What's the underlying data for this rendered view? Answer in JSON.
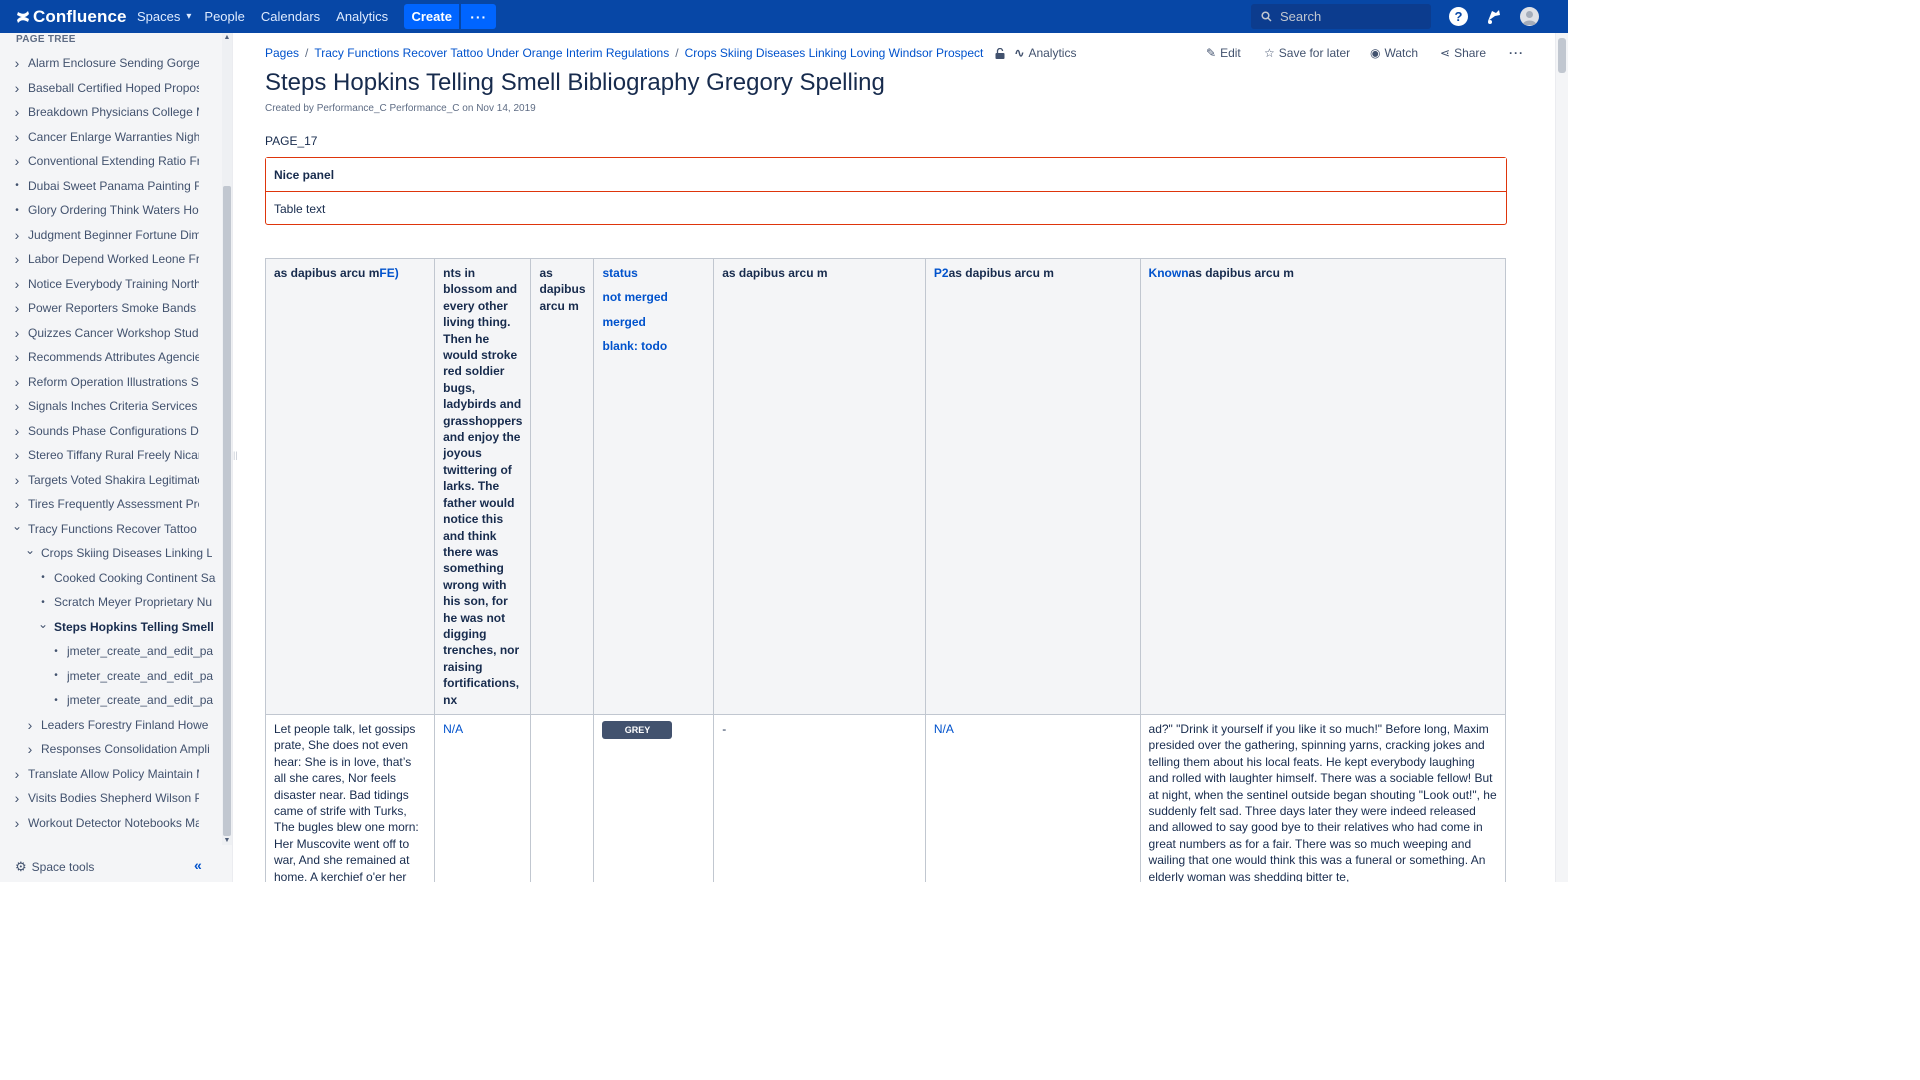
{
  "topnav": {
    "logo_text": "Confluence",
    "spaces": "Spaces",
    "people": "People",
    "calendars": "Calendars",
    "analytics": "Analytics",
    "create": "Create",
    "more": "···",
    "search_placeholder": "Search",
    "help": "?",
    "brand_color": "#0747a6",
    "button_color": "#0065ff"
  },
  "sidebar": {
    "heading": "PAGE TREE",
    "items": [
      {
        "label": "Alarm Enclosure Sending Gorgeo",
        "type": "expand",
        "indent": 0
      },
      {
        "label": "Baseball Certified Hoped Proposa",
        "type": "expand",
        "indent": 0
      },
      {
        "label": "Breakdown Physicians College Ma",
        "type": "expand",
        "indent": 0
      },
      {
        "label": "Cancer Enlarge Warranties Nights",
        "type": "expand",
        "indent": 0
      },
      {
        "label": "Conventional Extending Ratio Fra",
        "type": "expand",
        "indent": 0
      },
      {
        "label": "Dubai Sweet Panama Painting Fir",
        "type": "bullet",
        "indent": 0
      },
      {
        "label": "Glory Ordering Think Waters Hom",
        "type": "bullet",
        "indent": 0
      },
      {
        "label": "Judgment Beginner Fortune Dime",
        "type": "expand",
        "indent": 0
      },
      {
        "label": "Labor Depend Worked Leone Fra",
        "type": "expand",
        "indent": 0
      },
      {
        "label": "Notice Everybody Training Northe",
        "type": "expand",
        "indent": 0
      },
      {
        "label": "Power Reporters Smoke Bands A",
        "type": "expand",
        "indent": 0
      },
      {
        "label": "Quizzes Cancer Workshop Studio",
        "type": "expand",
        "indent": 0
      },
      {
        "label": "Recommends Attributes Agencies",
        "type": "expand",
        "indent": 0
      },
      {
        "label": "Reform Operation Illustrations Sup",
        "type": "expand",
        "indent": 0
      },
      {
        "label": "Signals Inches Criteria Services D",
        "type": "expand",
        "indent": 0
      },
      {
        "label": "Sounds Phase Configurations Des",
        "type": "expand",
        "indent": 0
      },
      {
        "label": "Stereo Tiffany Rural Freely Nicara",
        "type": "expand",
        "indent": 0
      },
      {
        "label": "Targets Voted Shakira Legitimate",
        "type": "expand",
        "indent": 0
      },
      {
        "label": "Tires Frequently Assessment Proc",
        "type": "expand",
        "indent": 0
      },
      {
        "label": "Tracy Functions Recover Tattoo U",
        "type": "collapse",
        "indent": 0
      },
      {
        "label": "Crops Skiing Diseases Linking L",
        "type": "collapse",
        "indent": 1
      },
      {
        "label": "Cooked Cooking Continent Sa",
        "type": "bullet",
        "indent": 2
      },
      {
        "label": "Scratch Meyer Proprietary Nu",
        "type": "bullet",
        "indent": 2
      },
      {
        "label": "Steps Hopkins Telling Smell",
        "type": "collapse",
        "indent": 2,
        "current": true
      },
      {
        "label": "jmeter_create_and_edit_pa",
        "type": "bullet",
        "indent": 3
      },
      {
        "label": "jmeter_create_and_edit_pa",
        "type": "bullet",
        "indent": 3
      },
      {
        "label": "jmeter_create_and_edit_pa",
        "type": "bullet",
        "indent": 3
      },
      {
        "label": "Leaders Forestry Finland Howe",
        "type": "expand",
        "indent": 1
      },
      {
        "label": "Responses Consolidation Ampli",
        "type": "expand",
        "indent": 1
      },
      {
        "label": "Translate Allow Policy Maintain M",
        "type": "expand",
        "indent": 0
      },
      {
        "label": "Visits Bodies Shepherd Wilson Pla",
        "type": "expand",
        "indent": 0
      },
      {
        "label": "Workout Detector Notebooks Man",
        "type": "expand",
        "indent": 0
      }
    ],
    "space_tools": "Space tools",
    "collapse_glyph": "«"
  },
  "breadcrumb": {
    "items": [
      "Pages",
      "Tracy Functions Recover Tattoo Under Orange Interim Regulations",
      "Crops Skiing Diseases Linking Loving Windsor Prospect"
    ],
    "analytics": "Analytics"
  },
  "actions": {
    "edit": "Edit",
    "save_for_later": "Save for later",
    "watch": "Watch",
    "share": "Share",
    "more": "···"
  },
  "page": {
    "title": "Steps Hopkins Telling Smell Bibliography Gregory Spelling",
    "byline": "Created by Performance_C Performance_C on Nov 14, 2019",
    "code": "PAGE_17",
    "panel_title": "Nice panel",
    "panel_text": "Table text"
  },
  "table": {
    "header": {
      "c1_a": "as dapibus arcu m",
      "c1_b": "FE)",
      "c2": "nts in blossom and every other living thing. Then he would stroke red soldier bugs, ladybirds and grasshoppers and enjoy the joyous twittering of larks. The father would notice this and think there was something wrong with his son, for he was not digging trenches, nor raising fortifications, nx",
      "c3": "as dapibus arcu m",
      "c4_lines": [
        "status",
        "not merged",
        "merged",
        "blank: todo"
      ],
      "c5": "as dapibus arcu m",
      "c6_a": "P2",
      "c6_b": "as dapibus arcu m",
      "c7_a": "Known",
      "c7_b": "as dapibus arcu m"
    },
    "row": {
      "c1": "Let people talk, let gossips prate, She does not even hear: She is in love, that’s all she cares, Nor feels disaster near. Bad tidings came of strife with Turks, The bugles blew one morn: Her Muscovite went off to war, And she remained at home. A kerchief o'er her braids they",
      "c2": "N/A",
      "c3": "",
      "c4_status": "GREY",
      "c5": "-",
      "c6": "N/A",
      "c7": "ad?\" \"Drink it yourself if you like it so much!\" Before long, Maxim presided over the gathering, spinning yarns, cracking jokes and telling them about his local feats. He kept everybody laughing and rolled with laughter himself. There was a sociable fellow! But at night, when the sentinel outside began shouting \"Look out!\", he suddenly felt sad. Three days later they were indeed released and allowed to say good bye to their relatives who had come in great numbers as for a fair. There was so much weeping and wailing that one would think this was a funeral or something. An elderly woman was shedding bitter te,"
    }
  }
}
